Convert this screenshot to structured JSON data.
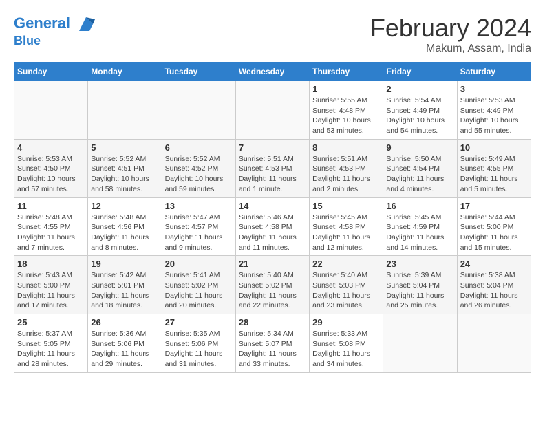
{
  "header": {
    "logo_line1": "General",
    "logo_line2": "Blue",
    "month": "February 2024",
    "location": "Makum, Assam, India"
  },
  "columns": [
    "Sunday",
    "Monday",
    "Tuesday",
    "Wednesday",
    "Thursday",
    "Friday",
    "Saturday"
  ],
  "weeks": [
    [
      {
        "day": "",
        "details": ""
      },
      {
        "day": "",
        "details": ""
      },
      {
        "day": "",
        "details": ""
      },
      {
        "day": "",
        "details": ""
      },
      {
        "day": "1",
        "details": "Sunrise: 5:55 AM\nSunset: 4:48 PM\nDaylight: 10 hours\nand 53 minutes."
      },
      {
        "day": "2",
        "details": "Sunrise: 5:54 AM\nSunset: 4:49 PM\nDaylight: 10 hours\nand 54 minutes."
      },
      {
        "day": "3",
        "details": "Sunrise: 5:53 AM\nSunset: 4:49 PM\nDaylight: 10 hours\nand 55 minutes."
      }
    ],
    [
      {
        "day": "4",
        "details": "Sunrise: 5:53 AM\nSunset: 4:50 PM\nDaylight: 10 hours\nand 57 minutes."
      },
      {
        "day": "5",
        "details": "Sunrise: 5:52 AM\nSunset: 4:51 PM\nDaylight: 10 hours\nand 58 minutes."
      },
      {
        "day": "6",
        "details": "Sunrise: 5:52 AM\nSunset: 4:52 PM\nDaylight: 10 hours\nand 59 minutes."
      },
      {
        "day": "7",
        "details": "Sunrise: 5:51 AM\nSunset: 4:53 PM\nDaylight: 11 hours\nand 1 minute."
      },
      {
        "day": "8",
        "details": "Sunrise: 5:51 AM\nSunset: 4:53 PM\nDaylight: 11 hours\nand 2 minutes."
      },
      {
        "day": "9",
        "details": "Sunrise: 5:50 AM\nSunset: 4:54 PM\nDaylight: 11 hours\nand 4 minutes."
      },
      {
        "day": "10",
        "details": "Sunrise: 5:49 AM\nSunset: 4:55 PM\nDaylight: 11 hours\nand 5 minutes."
      }
    ],
    [
      {
        "day": "11",
        "details": "Sunrise: 5:48 AM\nSunset: 4:55 PM\nDaylight: 11 hours\nand 7 minutes."
      },
      {
        "day": "12",
        "details": "Sunrise: 5:48 AM\nSunset: 4:56 PM\nDaylight: 11 hours\nand 8 minutes."
      },
      {
        "day": "13",
        "details": "Sunrise: 5:47 AM\nSunset: 4:57 PM\nDaylight: 11 hours\nand 9 minutes."
      },
      {
        "day": "14",
        "details": "Sunrise: 5:46 AM\nSunset: 4:58 PM\nDaylight: 11 hours\nand 11 minutes."
      },
      {
        "day": "15",
        "details": "Sunrise: 5:45 AM\nSunset: 4:58 PM\nDaylight: 11 hours\nand 12 minutes."
      },
      {
        "day": "16",
        "details": "Sunrise: 5:45 AM\nSunset: 4:59 PM\nDaylight: 11 hours\nand 14 minutes."
      },
      {
        "day": "17",
        "details": "Sunrise: 5:44 AM\nSunset: 5:00 PM\nDaylight: 11 hours\nand 15 minutes."
      }
    ],
    [
      {
        "day": "18",
        "details": "Sunrise: 5:43 AM\nSunset: 5:00 PM\nDaylight: 11 hours\nand 17 minutes."
      },
      {
        "day": "19",
        "details": "Sunrise: 5:42 AM\nSunset: 5:01 PM\nDaylight: 11 hours\nand 18 minutes."
      },
      {
        "day": "20",
        "details": "Sunrise: 5:41 AM\nSunset: 5:02 PM\nDaylight: 11 hours\nand 20 minutes."
      },
      {
        "day": "21",
        "details": "Sunrise: 5:40 AM\nSunset: 5:02 PM\nDaylight: 11 hours\nand 22 minutes."
      },
      {
        "day": "22",
        "details": "Sunrise: 5:40 AM\nSunset: 5:03 PM\nDaylight: 11 hours\nand 23 minutes."
      },
      {
        "day": "23",
        "details": "Sunrise: 5:39 AM\nSunset: 5:04 PM\nDaylight: 11 hours\nand 25 minutes."
      },
      {
        "day": "24",
        "details": "Sunrise: 5:38 AM\nSunset: 5:04 PM\nDaylight: 11 hours\nand 26 minutes."
      }
    ],
    [
      {
        "day": "25",
        "details": "Sunrise: 5:37 AM\nSunset: 5:05 PM\nDaylight: 11 hours\nand 28 minutes."
      },
      {
        "day": "26",
        "details": "Sunrise: 5:36 AM\nSunset: 5:06 PM\nDaylight: 11 hours\nand 29 minutes."
      },
      {
        "day": "27",
        "details": "Sunrise: 5:35 AM\nSunset: 5:06 PM\nDaylight: 11 hours\nand 31 minutes."
      },
      {
        "day": "28",
        "details": "Sunrise: 5:34 AM\nSunset: 5:07 PM\nDaylight: 11 hours\nand 33 minutes."
      },
      {
        "day": "29",
        "details": "Sunrise: 5:33 AM\nSunset: 5:08 PM\nDaylight: 11 hours\nand 34 minutes."
      },
      {
        "day": "",
        "details": ""
      },
      {
        "day": "",
        "details": ""
      }
    ]
  ]
}
